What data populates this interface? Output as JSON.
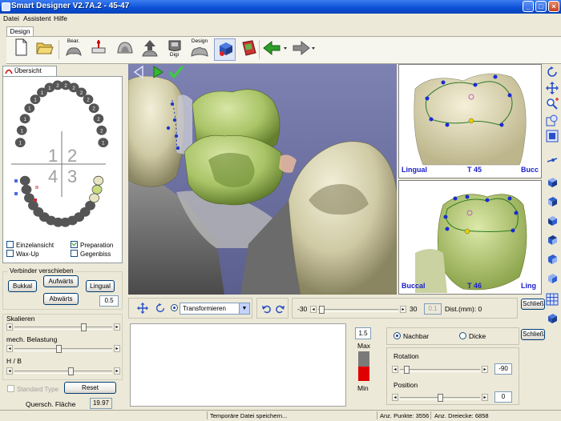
{
  "window": {
    "title": "Smart Designer V2.7A.2 - 45-47",
    "minimize": "_",
    "maximize": "□",
    "close": "×"
  },
  "menu": [
    "Datei",
    "Assistent",
    "Hilfe"
  ],
  "ribbon": {
    "tab": "Design",
    "buttons": [
      {
        "name": "new-document-icon",
        "label": ""
      },
      {
        "name": "open-folder-icon",
        "label": ""
      },
      {
        "name": "bearbeiten-icon",
        "label": "Bear."
      },
      {
        "name": "align-tool-icon",
        "label": ""
      },
      {
        "name": "dome-icon",
        "label": ""
      },
      {
        "name": "upload-scan-icon",
        "label": ""
      },
      {
        "name": "digi-icon",
        "label": "Digi"
      },
      {
        "name": "design-icon",
        "label": "Design"
      },
      {
        "name": "cube-tools-icon",
        "label": ""
      },
      {
        "name": "texture-book-icon",
        "label": ""
      }
    ]
  },
  "left": {
    "tab": "Übersicht",
    "quadrants": [
      "1",
      "2",
      "4",
      "3"
    ],
    "upper_teeth": [
      "1",
      "1",
      "1",
      "1",
      "1",
      "1",
      "1",
      "2",
      "2",
      "2",
      "2",
      "2",
      "2",
      "2",
      "2"
    ],
    "checkboxes": [
      {
        "label": "Einzelansicht",
        "checked": false
      },
      {
        "label": "Preparation",
        "checked": true
      },
      {
        "label": "Wax-Up",
        "checked": false
      },
      {
        "label": "Gegenbiss",
        "checked": false
      }
    ],
    "connector": {
      "legend": "Verbinder verschieben",
      "bukkal": "Bukkal",
      "aufwarts": "Aufwärts",
      "lingual": "Lingual",
      "abwarts": "Abwärts",
      "value": "0.5"
    },
    "scale": {
      "label": "Skalieren",
      "level": 0.72
    },
    "load": {
      "label": "mech. Belastung",
      "level": 0.45
    },
    "hb": {
      "label": "H / B",
      "level": 0.58
    },
    "standard_type": "Standard Type",
    "reset": "Reset",
    "cross_label": "Quersch. Fläche",
    "cross_value": "19.97"
  },
  "views": {
    "t45": {
      "left": "Lingual",
      "center": "T 45",
      "right": "Bucc"
    },
    "t46": {
      "left": "Buccal",
      "center": "T 46",
      "right": "Ling"
    }
  },
  "controls": {
    "mode": "Transformieren",
    "dist_min": "-30",
    "dist_max": "30",
    "dist_field": "0.1",
    "dist_label": "Dist.(mm): 0",
    "schliess1": "Schließ",
    "schliess2": "Schließ"
  },
  "bottom": {
    "max_value": "1.5",
    "max_label": "Max",
    "min_label": "Min",
    "nachbar": "Nachbar",
    "dicke": "Dicke",
    "rotation_label": "Rotation",
    "rotation_value": "-90",
    "rotation_level": 0.05,
    "position_label": "Position",
    "position_value": "0",
    "position_level": 0.5
  },
  "status": {
    "saving": "Temporäre Datei speichern...",
    "points": "Anz. Punkte: 3556",
    "triangles": "Anz. Dreiecke: 6858"
  }
}
